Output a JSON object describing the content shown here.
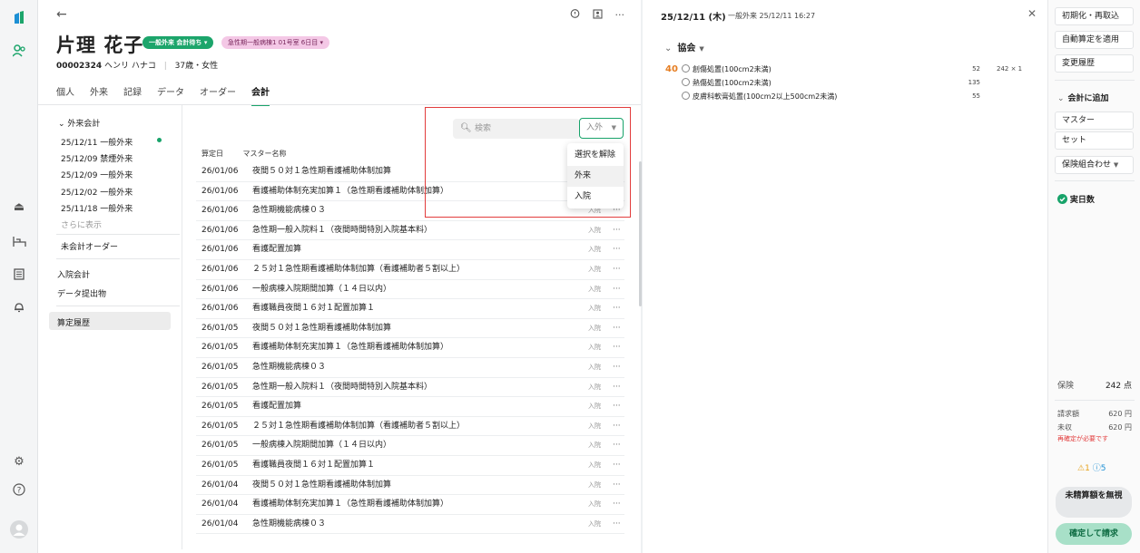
{
  "main": {
    "back_icon": "arrow-left-icon",
    "patient": {
      "name": "片理 花子",
      "status_tag": "一般外来 会計待ち",
      "ward_tag": "急性期一般病棟1 01号室 6日目",
      "id": "00002324",
      "kana": "ヘンリ ハナコ",
      "age_gender": "37歳・女性"
    },
    "tabs": [
      {
        "label": "個人"
      },
      {
        "label": "外来"
      },
      {
        "label": "記録"
      },
      {
        "label": "データ"
      },
      {
        "label": "オーダー"
      },
      {
        "label": "会計"
      }
    ],
    "active_tab": "会計",
    "sidebar": {
      "group_label": "外来会計",
      "visits": [
        "25/12/11 一般外来",
        "25/12/09 禁煙外来",
        "25/12/09 一般外来",
        "25/12/02 一般外来",
        "25/11/18 一般外来"
      ],
      "show_more": "さらに表示",
      "unbilled": "未会計オーダー",
      "inpatient": "入院会計",
      "data_submission": "データ提出物",
      "history": "算定履歴"
    },
    "search": {
      "placeholder": "検索"
    },
    "filter": {
      "selected": "入外",
      "options": [
        "選択を解除",
        "外来",
        "入院"
      ],
      "highlighted": "外来"
    },
    "table": {
      "headers": [
        "算定日",
        "マスター名称"
      ],
      "rows": [
        {
          "date": "26/01/06",
          "name": "夜間５０対１急性期看護補助体制加算"
        },
        {
          "date": "26/01/06",
          "name": "看護補助体制充実加算１（急性期看護補助体制加算）"
        },
        {
          "date": "26/01/06",
          "name": "急性期機能病棟０３",
          "type": "入院"
        },
        {
          "date": "26/01/06",
          "name": "急性期一般入院料１（夜間時間特別入院基本料）",
          "type": "入院"
        },
        {
          "date": "26/01/06",
          "name": "看護配置加算",
          "type": "入院"
        },
        {
          "date": "26/01/06",
          "name": "２５対１急性期看護補助体制加算（看護補助者５割以上）",
          "type": "入院"
        },
        {
          "date": "26/01/06",
          "name": "一般病棟入院期間加算（１４日以内）",
          "type": "入院"
        },
        {
          "date": "26/01/06",
          "name": "看護職員夜間１６対１配置加算１",
          "type": "入院"
        },
        {
          "date": "26/01/05",
          "name": "夜間５０対１急性期看護補助体制加算",
          "type": "入院"
        },
        {
          "date": "26/01/05",
          "name": "看護補助体制充実加算１（急性期看護補助体制加算）",
          "type": "入院"
        },
        {
          "date": "26/01/05",
          "name": "急性期機能病棟０３",
          "type": "入院"
        },
        {
          "date": "26/01/05",
          "name": "急性期一般入院料１（夜間時間特別入院基本料）",
          "type": "入院"
        },
        {
          "date": "26/01/05",
          "name": "看護配置加算",
          "type": "入院"
        },
        {
          "date": "26/01/05",
          "name": "２５対１急性期看護補助体制加算（看護補助者５割以上）",
          "type": "入院"
        },
        {
          "date": "26/01/05",
          "name": "一般病棟入院期間加算（１４日以内）",
          "type": "入院"
        },
        {
          "date": "26/01/05",
          "name": "看護職員夜間１６対１配置加算１",
          "type": "入院"
        },
        {
          "date": "26/01/04",
          "name": "夜間５０対１急性期看護補助体制加算",
          "type": "入院"
        },
        {
          "date": "26/01/04",
          "name": "看護補助体制充実加算１（急性期看護補助体制加算）",
          "type": "入院"
        },
        {
          "date": "26/01/04",
          "name": "急性期機能病棟０３",
          "type": "入院"
        }
      ]
    }
  },
  "detail": {
    "date": "25/12/11 (木)",
    "sub": "一般外来 25/12/11 16:27",
    "group": "協会",
    "count": "40",
    "items": [
      {
        "name": "創傷処置(100cm2未満)",
        "points": "52",
        "extra": "242 × 1"
      },
      {
        "name": "熱傷処置(100cm2未満)",
        "points": "135"
      },
      {
        "name": "皮膚科軟膏処置(100cm2以上500cm2未満)",
        "points": "55"
      }
    ]
  },
  "right_panel": {
    "buttons": [
      "初期化・再取込",
      "自動算定を適用",
      "変更履歴"
    ],
    "add_section": "会計に追加",
    "add_items": [
      "マスター",
      "セット"
    ],
    "insurance_combo": "保険組合わせ",
    "days_label": "実日数",
    "insurance_label": "保険",
    "insurance_points": "242 点",
    "billed_label": "請求額",
    "billed_value": "620 円",
    "unpaid_label": "未収",
    "unpaid_value": "620 円",
    "recalc_warning": "再確定が必要です",
    "warn_count": "1",
    "info_count": "5",
    "ignore_button": "未精算額を無視",
    "confirm_button": "確定して請求"
  },
  "colors": {
    "accent": "#18a36a",
    "warning": "#e67e22",
    "highlight_box": "#e23c3c"
  }
}
